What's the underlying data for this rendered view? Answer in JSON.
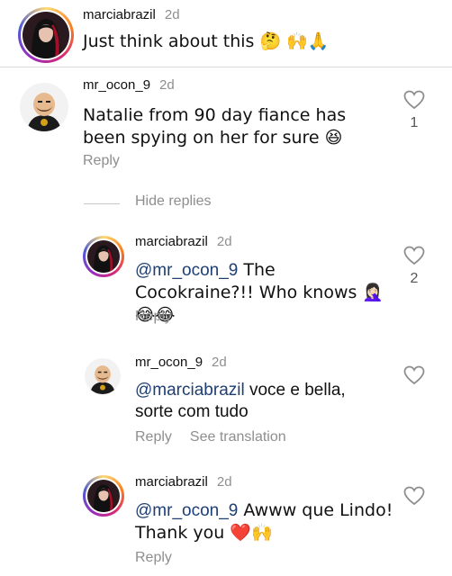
{
  "comments": [
    {
      "username": "marciabrazil",
      "age": "2d",
      "text": "Just think about this 🤔 🙌🙏"
    },
    {
      "username": "mr_ocon_9",
      "age": "2d",
      "text": "Natalie from 90 day fiance has been spying on her for sure 😆",
      "likes": "1",
      "reply_label": "Reply"
    }
  ],
  "hide_replies_label": "Hide replies",
  "replies": [
    {
      "username": "marciabrazil",
      "age": "2d",
      "mention": "@mr_ocon_9",
      "text": " The Cocokraine?!! Who knows 🤦🏻‍♀️😂😂",
      "likes": "2",
      "reply_label": "Reply"
    },
    {
      "username": "mr_ocon_9",
      "age": "2d",
      "mention": "@marciabrazil",
      "text": " voce e bella, sorte com tudo",
      "reply_label": "Reply",
      "see_translation_label": "See translation"
    },
    {
      "username": "marciabrazil",
      "age": "2d",
      "mention": "@mr_ocon_9",
      "text": " Awww que Lindo! Thank you ❤️🙌",
      "reply_label": "Reply"
    }
  ],
  "colors": {
    "mention": "#1d3f73",
    "muted": "#8e8e8e",
    "divider": "#dbdbdb"
  }
}
